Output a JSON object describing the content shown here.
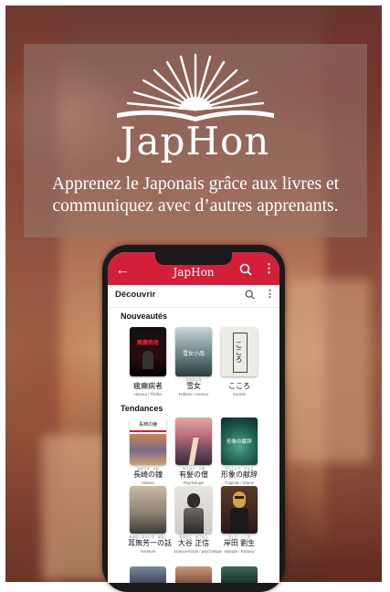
{
  "promo": {
    "brand": "JapHon",
    "tagline_line1": "Apprenez le Japonais grâce aux livres et",
    "tagline_line2": "communiquez avec d’autres apprenants."
  },
  "app": {
    "title": "JapHon",
    "section_title": "Découvrir",
    "accent": "#d31f3a",
    "sections": {
      "new": "Nouveautés",
      "trending": "Tendances"
    },
    "new_books": [
      {
        "ruby": "",
        "title": "瘋癲病者",
        "genre": "Horreur / Thriller",
        "cover_text": "瘋癲病者"
      },
      {
        "ruby": "ゆきおんな",
        "title": "雪女",
        "genre": "Folklore / Horreur",
        "cover_text": "雪女小品"
      },
      {
        "ruby": "",
        "title": "こころ",
        "genre": "Société",
        "cover_text": "こころ"
      }
    ],
    "trending_books": [
      {
        "ruby": "ながさき　かね",
        "title": "長崎の鐘",
        "genre": "Histoire",
        "cover_text": "長崎の鐘"
      },
      {
        "ruby": "ゆうはつ　つみ",
        "title": "有髪の僧",
        "genre": "Psychologie",
        "cover_text": ""
      },
      {
        "ruby": "けいしょう　けんじ",
        "title": "形象の献辞",
        "genre": "Tragédie / Drame",
        "cover_text": "形象の献辞"
      },
      {
        "ruby": "みみなしほういち　はなし",
        "title": "耳無芳一の話",
        "genre": "Aventure",
        "cover_text": ""
      },
      {
        "ruby": "おおたに　まさのぶ",
        "title": "大谷 正信",
        "genre": "Science-fiction / psychologie",
        "cover_text": ""
      },
      {
        "ruby": "きしだ　くにお",
        "title": "岸田 劉生",
        "genre": "Maladie / Fantasy",
        "cover_text": ""
      }
    ]
  },
  "icons": {
    "back": "arrow-left-icon",
    "search": "search-icon",
    "menu": "more-vertical-icon",
    "logo": "open-book-sunburst-logo"
  }
}
